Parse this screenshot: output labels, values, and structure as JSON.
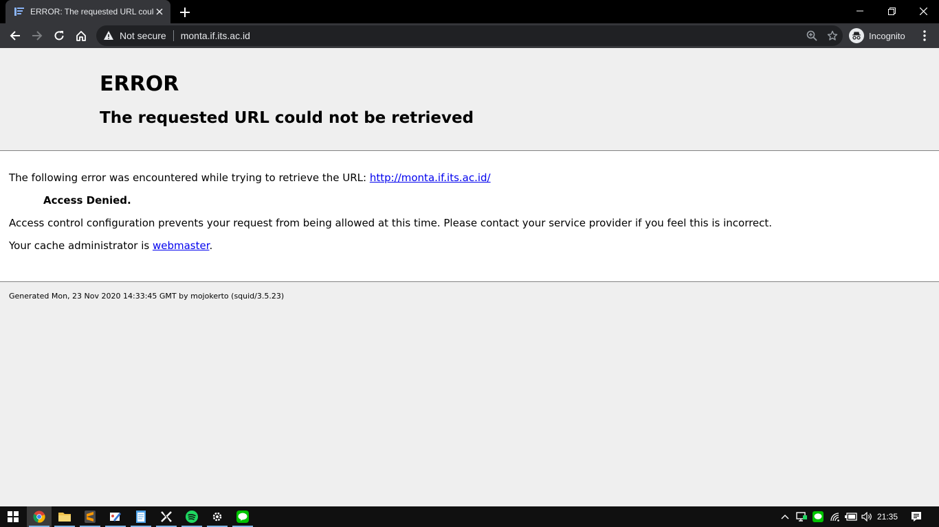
{
  "browser": {
    "tab_title": "ERROR: The requested URL could not be retrieved",
    "security_label": "Not secure",
    "url": "monta.if.its.ac.id",
    "profile_label": "Incognito"
  },
  "page": {
    "heading": "ERROR",
    "subheading": "The requested URL could not be retrieved",
    "intro_text": "The following error was encountered while trying to retrieve the URL: ",
    "requested_url": "http://monta.if.its.ac.id/",
    "error_title": "Access Denied.",
    "error_description": "Access control configuration prevents your request from being allowed at this time. Please contact your service provider if you feel this is incorrect.",
    "admin_text": "Your cache administrator is ",
    "admin_link": "webmaster",
    "admin_suffix": ".",
    "footer": "Generated Mon, 23 Nov 2020 14:33:45 GMT by mojokerto (squid/3.5.23)"
  },
  "taskbar": {
    "apps": [
      "chrome-icon",
      "file-explorer-icon",
      "sublime-text-icon",
      "paint-icon",
      "notepad-icon",
      "xampp-icon",
      "spotify-icon",
      "settings-icon",
      "line-icon"
    ],
    "clock": "21:35"
  }
}
